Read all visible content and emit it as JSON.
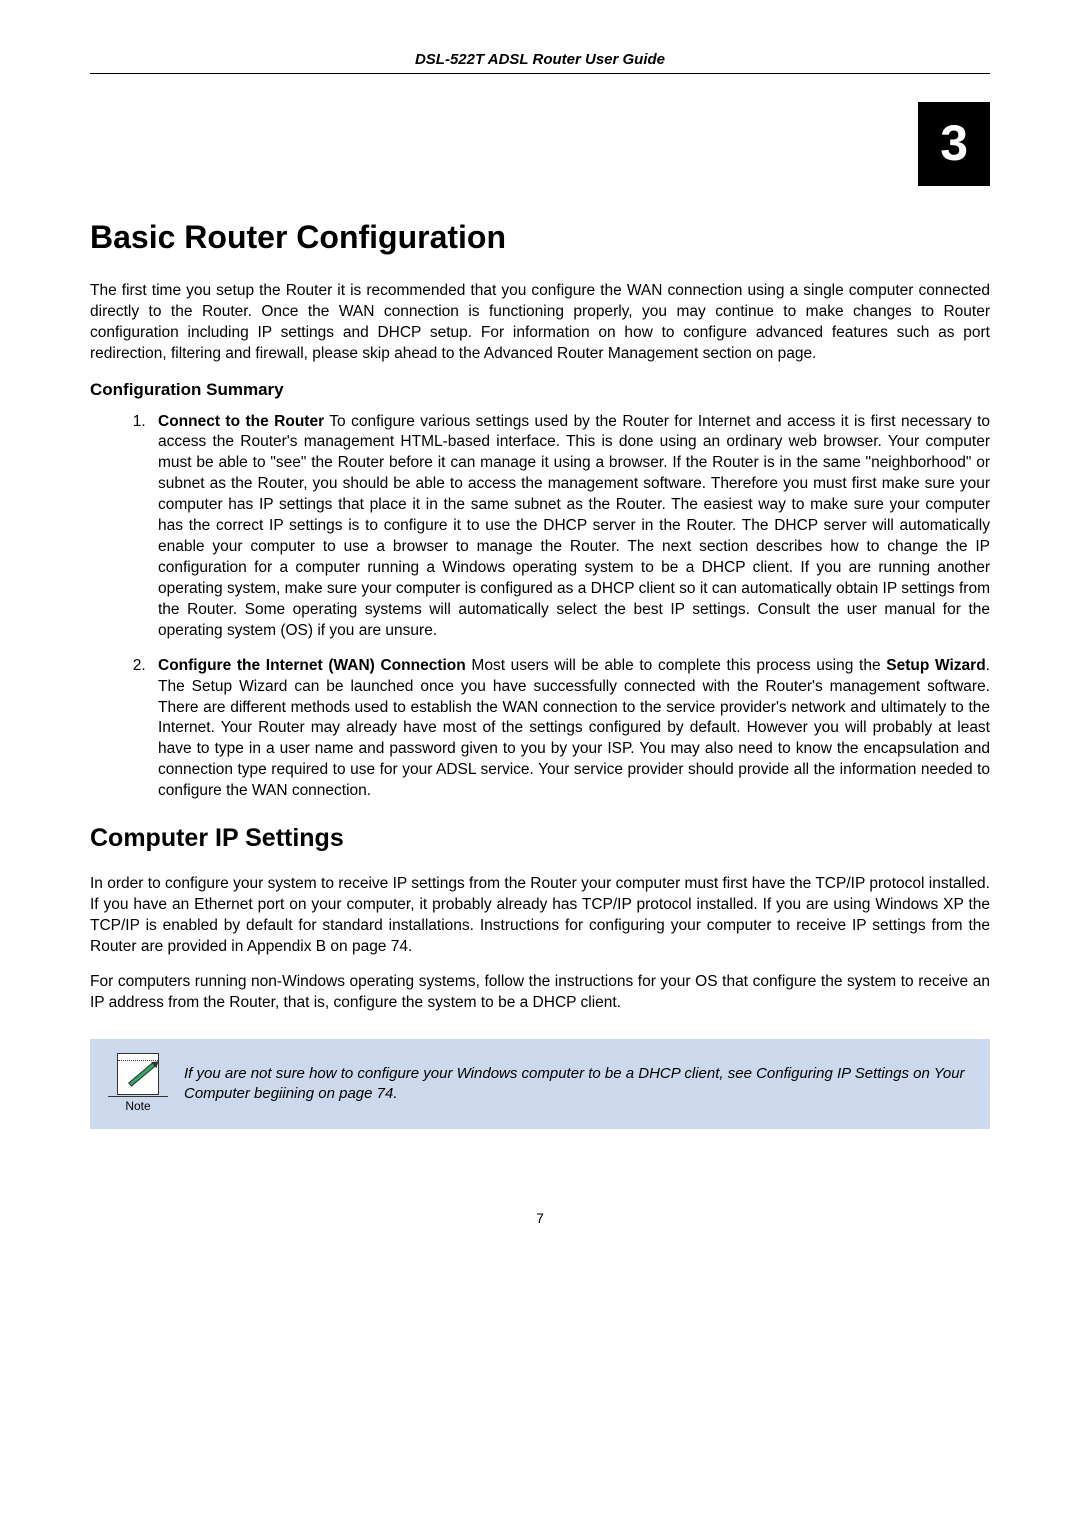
{
  "header": "DSL-522T ADSL Router User Guide",
  "chapter_number": "3",
  "title": "Basic Router Configuration",
  "intro": "The first time you setup the Router it is recommended that you configure the WAN connection using a single computer connected directly to the Router. Once the WAN connection is functioning properly, you may continue to make changes to Router configuration including IP settings and DHCP setup. For information on how to configure advanced features such as port redirection, filtering and firewall, please skip ahead to the Advanced Router Management section on page.",
  "config_summary_heading": "Configuration Summary",
  "item1_lead": "Connect to the Router",
  "item1_rest": " To configure various settings used by the Router for Internet and access it is first necessary to access the Router's management HTML-based interface. This is done using an ordinary web browser. Your computer must be able to \"see\" the Router before it can manage it using a browser. If the Router is in the same \"neighborhood\" or subnet as the Router, you should be able to access the management software. Therefore you must first make sure your computer has IP settings that place it in the same subnet as the Router. The easiest way to make sure your computer has the correct IP settings is to configure it to use the DHCP server in the Router. The DHCP server will automatically enable your computer to use a browser to manage the Router. The next section describes how to change the IP configuration for a computer running a Windows operating system to be a DHCP client. If you are running another operating system, make sure your computer is configured as a DHCP client so it can automatically obtain IP settings from the Router. Some operating systems will automatically select the best IP settings. Consult the user manual for the operating system (OS) if you are unsure.",
  "item2_lead": "Configure the Internet (WAN) Connection",
  "item2_mid1": " Most users will be able to complete this process using the ",
  "item2_bold2": "Setup Wizard",
  "item2_rest": ". The Setup Wizard can be launched once you have successfully connected with the Router's management software.  There are different methods used to establish the WAN connection to the service provider's network and ultimately to the Internet. Your Router may already have most of the settings configured by default. However you will probably at least have to type in a user name and password given to you by your ISP. You may also need to know the encapsulation and connection type required to use for your ADSL service. Your service provider should provide all the information needed to configure the WAN connection.",
  "section2_heading": "Computer IP Settings",
  "section2_p1": "In order to configure your system to receive IP settings from the Router your computer must first have the TCP/IP protocol installed. If you have an Ethernet port on your computer, it probably already has TCP/IP protocol installed. If you are using Windows XP the TCP/IP is enabled by default for standard installations. Instructions for configuring your computer to receive IP settings from the Router are provided in Appendix B on page 74.",
  "section2_p2": "For computers running non-Windows operating systems, follow the instructions for your OS that configure the system to receive an IP address from the Router, that is, configure the system to be a DHCP client.",
  "note_label": "Note",
  "note_text": "If you are not sure how to configure your Windows computer to be a DHCP client, see Configuring IP Settings on Your Computer begiining on page 74.",
  "page_number": "7"
}
